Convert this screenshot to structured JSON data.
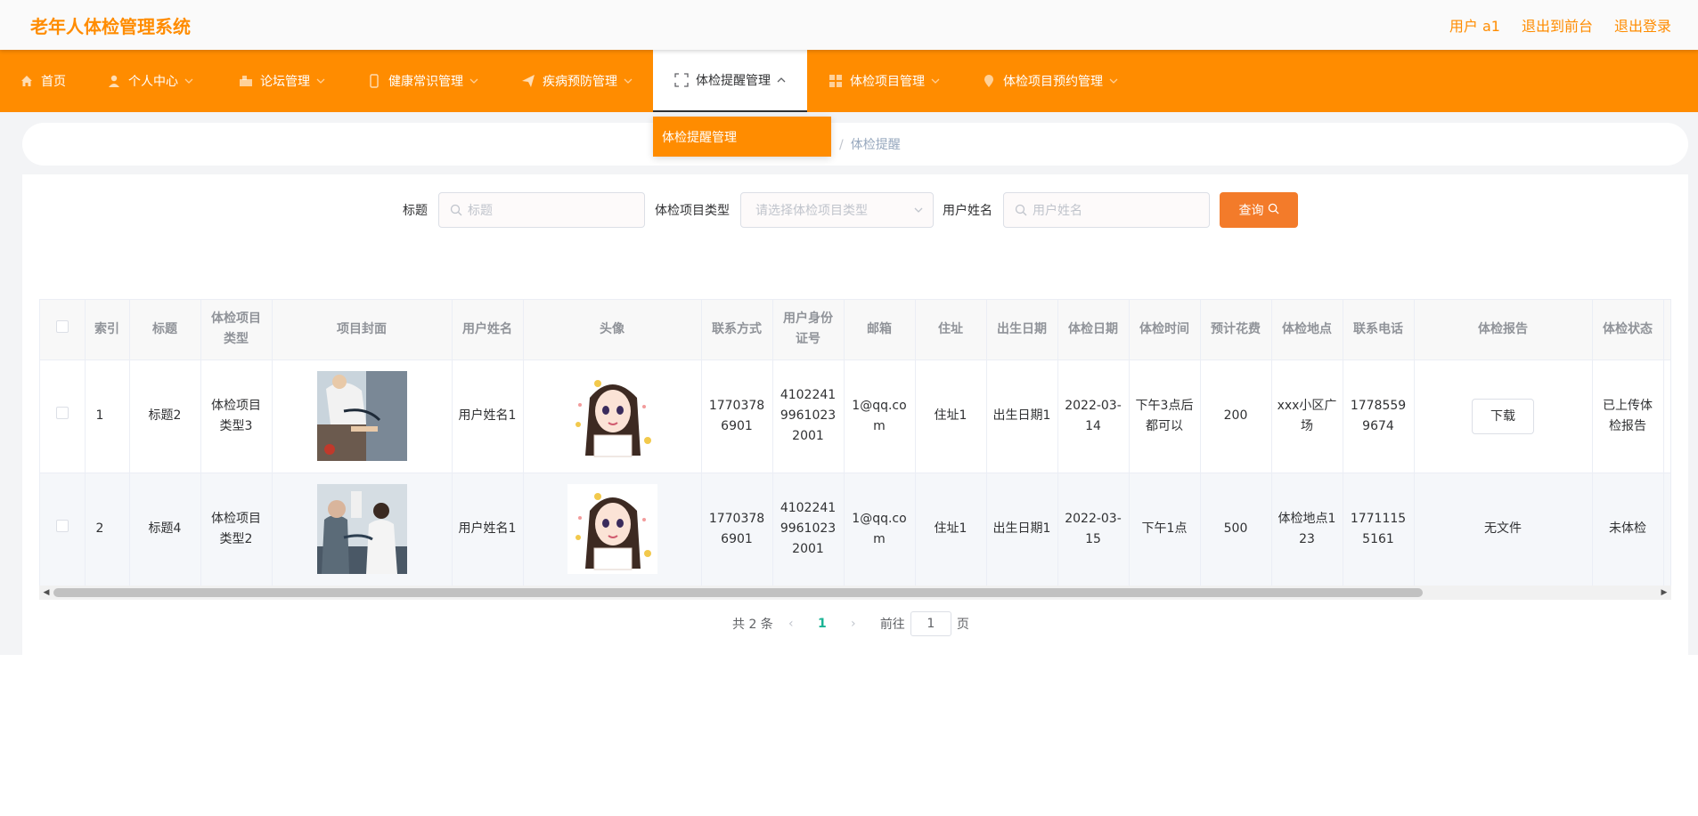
{
  "app": {
    "title": "老年人体检管理系统",
    "links": [
      "用户 a1",
      "退出到前台",
      "退出登录"
    ]
  },
  "nav": {
    "home": "首页",
    "personal": "个人中心",
    "forum": "论坛管理",
    "health_knowledge": "健康常识管理",
    "disease_prevention": "疾病预防管理",
    "reminder": "体检提醒管理",
    "project": "体检项目管理",
    "booking": "体检项目预约管理"
  },
  "dropdown": {
    "item": "体检提醒管理"
  },
  "breadcrumb": {
    "current": "体检提醒"
  },
  "search": {
    "title_label": "标题",
    "title_placeholder": "标题",
    "type_label": "体检项目类型",
    "type_placeholder": "请选择体检项目类型",
    "user_label": "用户姓名",
    "user_placeholder": "用户姓名",
    "query_button": "查询"
  },
  "table": {
    "headers": [
      "索引",
      "标题",
      "体检项目类型",
      "项目封面",
      "用户姓名",
      "头像",
      "联系方式",
      "用户身份证号",
      "邮箱",
      "住址",
      "出生日期",
      "体检日期",
      "体检时间",
      "预计花费",
      "体检地点",
      "联系电话",
      "体检报告",
      "体检状态"
    ],
    "rows": [
      {
        "index": "1",
        "title": "标题2",
        "type": "体检项目类型3",
        "username": "用户姓名1",
        "phone": "17703786901",
        "id_card": "410224199610232001",
        "email": "1@qq.com",
        "address": "住址1",
        "birth": "出生日期1",
        "exam_date": "2022-03-14",
        "exam_time": "下午3点后都可以",
        "cost": "200",
        "location": "xxx小区广场",
        "tel": "17785599674",
        "report": "下载",
        "status": "已上传体检报告"
      },
      {
        "index": "2",
        "title": "标题4",
        "type": "体检项目类型2",
        "username": "用户姓名1",
        "phone": "17703786901",
        "id_card": "410224199610232001",
        "email": "1@qq.com",
        "address": "住址1",
        "birth": "出生日期1",
        "exam_date": "2022-03-15",
        "exam_time": "下午1点",
        "cost": "500",
        "location": "体检地点123",
        "tel": "17711155161",
        "report": "无文件",
        "status": "未体检"
      }
    ]
  },
  "pagination": {
    "total": "共 2 条",
    "current_page": "1",
    "goto_label": "前往",
    "goto_value": "1",
    "page_suffix": "页"
  },
  "colors": {
    "brand": "#ff8c00",
    "query_button": "#f37b2a",
    "active_page": "#1ab394"
  }
}
